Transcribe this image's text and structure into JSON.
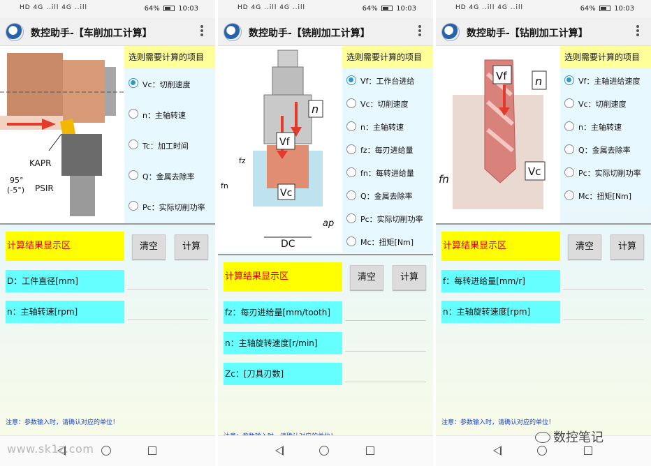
{
  "status": {
    "signal": "HD 4G ..ill 4G ..ill",
    "battery": "64%",
    "time": "10:03"
  },
  "phones": [
    {
      "title": "数控助手-【车削加工计算】",
      "options_header": "选则需要计算的项目",
      "options": [
        "Vc：切削速度",
        "n：主轴转速",
        "Tc：加工时间",
        "Q：金属去除率",
        "Pc：实际切削功率"
      ],
      "selected": 0,
      "result_label": "计算结果显示区",
      "clear_label": "清空",
      "calc_label": "计算",
      "fields": [
        {
          "label": "D：工件直径[mm]",
          "value": ""
        },
        {
          "label": "n：主轴转速[rpm]",
          "value": ""
        }
      ],
      "note": "注意：参数输入时，请确认对应的单位！",
      "diagram": {
        "kapr": "KAPR",
        "angle": "95°",
        "angle2": "(-5°)",
        "psir": "PSIR"
      }
    },
    {
      "title": "数控助手-【铣削加工计算】",
      "options_header": "选则需要计算的项目",
      "options": [
        "Vf：工作台进给",
        "Vc：切削速度",
        "n：主轴转速",
        "fz：每刃进给量",
        "fn：每转进给量",
        "Q：金属去除率",
        "Pc：实际切削功率",
        "Mc：扭矩[Nm]"
      ],
      "selected": 0,
      "result_label": "计算结果显示区",
      "clear_label": "清空",
      "calc_label": "计算",
      "fields": [
        {
          "label": "fz：每刃进给量[mm/tooth]",
          "value": ""
        },
        {
          "label": "n：主轴旋转速度[r/min]",
          "value": ""
        },
        {
          "label": "Zc：[刀具刃数]",
          "value": ""
        }
      ],
      "note": "注意：参数输入时，请确认对应的单位！",
      "diagram": {
        "n": "n",
        "vf": "Vf",
        "fz": "fz",
        "fn": "fn",
        "vc": "Vc",
        "dc": "DC",
        "ap": "ap"
      }
    },
    {
      "title": "数控助手-【钻削加工计算】",
      "options_header": "选则需要计算的项目",
      "options": [
        "Vf：主轴进给速度",
        "Vc：切削速度",
        "n：主轴转速",
        "Q：金属去除率",
        "Pc：实际切削功率",
        "Mc：扭矩[Nm]"
      ],
      "selected": 0,
      "result_label": "计算结果显示区",
      "clear_label": "清空",
      "calc_label": "计算",
      "fields": [
        {
          "label": "f：每转进给量[mm/r]",
          "value": ""
        },
        {
          "label": "n：主轴旋转速度[rpm]",
          "value": ""
        }
      ],
      "note": "注意：参数输入时，请确认对应的单位！",
      "diagram": {
        "vf": "Vf",
        "n": "n",
        "fn": "fn",
        "vc": "Vc"
      }
    }
  ],
  "watermark": "www.sk1z.com",
  "brand_logo": "数控笔记",
  "colors": {
    "result_bg": "#ffff00",
    "result_text": "#e60000",
    "field_bg": "#66ffff",
    "header_bg": "#ffff99",
    "note_text": "#1a44c8",
    "radio_on": "#2b9ac9"
  }
}
